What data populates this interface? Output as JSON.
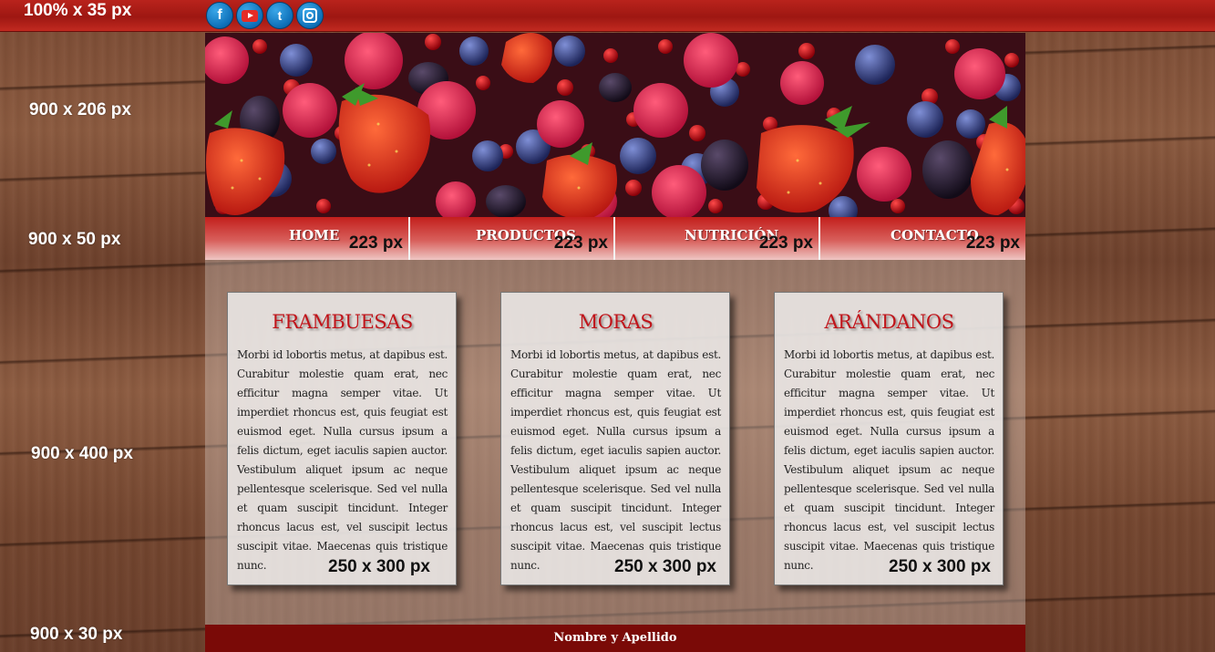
{
  "topbar": {
    "dimension_label": "100% x 35 px",
    "social": [
      {
        "name": "facebook",
        "glyph": "f"
      },
      {
        "name": "youtube",
        "glyph": ""
      },
      {
        "name": "twitter",
        "glyph": "t"
      },
      {
        "name": "instagram",
        "glyph": ""
      }
    ]
  },
  "side_labels": {
    "header": "900 x 206 px",
    "nav": "900 x 50 px",
    "main": "900 x 400 px",
    "footer": "900 x 30 px"
  },
  "nav": {
    "items": [
      {
        "label": "HOME",
        "size": "223 px"
      },
      {
        "label": "PRODUCTOS",
        "size": "223 px"
      },
      {
        "label": "NUTRICIÓN",
        "size": "223 px"
      },
      {
        "label": "CONTACTO",
        "size": "223 px"
      }
    ]
  },
  "cards": [
    {
      "title": "FRAMBUESAS",
      "body": "Morbi id lobortis metus, at dapibus est. Curabitur molestie quam erat, nec efficitur magna semper vitae. Ut imperdiet rhoncus est, quis feugiat est euismod eget. Nulla cursus ipsum a felis dictum, eget iaculis sapien auctor. Vestibulum aliquet ipsum ac neque pellentesque scelerisque. Sed vel nulla et quam suscipit tincidunt. Integer rhoncus lacus est, vel suscipit lectus suscipit vitae. Maecenas quis tristique nunc.",
      "size": "250 x 300 px"
    },
    {
      "title": "MORAS",
      "body": "Morbi id lobortis metus, at dapibus est. Curabitur molestie quam erat, nec efficitur magna semper vitae. Ut imperdiet rhoncus est, quis feugiat est euismod eget. Nulla cursus ipsum a felis dictum, eget iaculis sapien auctor. Vestibulum aliquet ipsum ac neque pellentesque scelerisque. Sed vel nulla et quam suscipit tincidunt. Integer rhoncus lacus est, vel suscipit lectus suscipit vitae. Maecenas quis tristique nunc.",
      "size": "250 x 300 px"
    },
    {
      "title": "ARÁNDANOS",
      "body": "Morbi id lobortis metus, at dapibus est. Curabitur molestie quam erat, nec efficitur magna semper vitae. Ut imperdiet rhoncus est, quis feugiat est euismod eget. Nulla cursus ipsum a felis dictum, eget iaculis sapien auctor. Vestibulum aliquet ipsum ac neque pellentesque scelerisque. Sed vel nulla et quam suscipit tincidunt. Integer rhoncus lacus est, vel suscipit lectus suscipit vitae. Maecenas quis tristique nunc.",
      "size": "250 x 300 px"
    }
  ],
  "footer": {
    "text": "Nombre y Apellido"
  },
  "colors": {
    "topbar_red": "#b9231c",
    "footer_red": "#7a0a07",
    "title_red": "#c0141a"
  }
}
